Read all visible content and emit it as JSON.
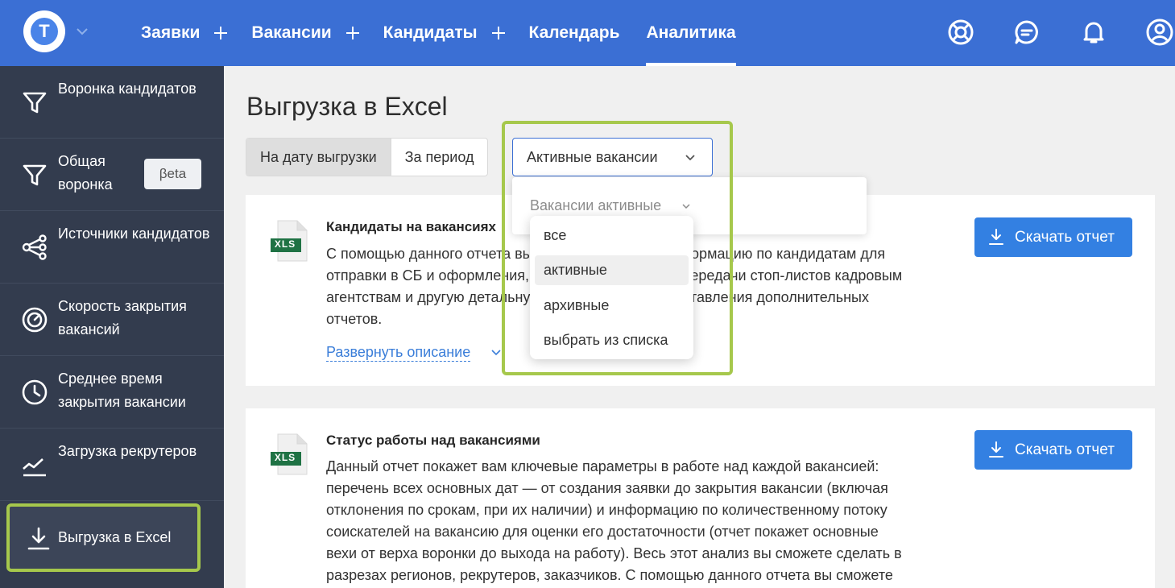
{
  "header": {
    "logo_letter": "T",
    "nav": [
      {
        "label": "Заявки"
      },
      {
        "label": "Вакансии"
      },
      {
        "label": "Кандидаты"
      },
      {
        "label": "Календарь"
      },
      {
        "label": "Аналитика"
      }
    ],
    "icons": [
      "support-icon",
      "chat-icon",
      "bell-icon",
      "user-icon"
    ]
  },
  "sidebar": {
    "items": [
      {
        "label": "Воронка кандидатов",
        "icon": "funnel-icon"
      },
      {
        "label": "Общая воронка",
        "icon": "funnel-icon",
        "badge": "βeta"
      },
      {
        "label": "Источники кандидатов",
        "icon": "share-nodes-icon"
      },
      {
        "label": "Скорость закрытия вакансий",
        "icon": "speedometer-icon"
      },
      {
        "label": "Среднее время закрытия вакансии",
        "icon": "clock-icon"
      },
      {
        "label": "Загрузка рекрутеров",
        "icon": "trend-line-icon"
      },
      {
        "label": "Выгрузка в Excel",
        "icon": "download-icon"
      }
    ]
  },
  "main": {
    "title": "Выгрузка в Excel",
    "tabs": [
      {
        "label": "На дату выгрузки",
        "selected": true
      },
      {
        "label": "За период",
        "selected": false
      }
    ],
    "select": {
      "value": "Активные вакансии"
    },
    "dropdown": {
      "title": "Вакансии активные",
      "options": [
        "все",
        "активные",
        "архивные",
        "выбрать из списка"
      ],
      "highlighted": "активные"
    },
    "cards": [
      {
        "badge": "XLS",
        "title": "Кандидаты на вакансиях",
        "lines": [
          "С помощью данного отчета вы сможете получить информацию по кандидатам для",
          "отправки в СБ и оформления, сделать выгрузку для передачи стоп-листов кадровым",
          "агентствам и другую детальную информацию для составления дополнительных",
          "отчетов."
        ],
        "expand": "Развернуть описание",
        "button": "Скачать отчет"
      },
      {
        "badge": "XLS",
        "title": "Статус работы над вакансиями",
        "lines": [
          "Данный отчет покажет вам ключевые параметры в работе над каждой вакансией:",
          "перечень всех основных дат — от создания заявки до закрытия вакансии (включая",
          "отклонения по срокам, при их наличии) и информацию по количественному потоку",
          "соискателей на вакансию для оценки его достаточности (отчет покажет основные",
          "вехи от верха воронки до выхода на работу). Весь этот анализ вы сможете сделать в",
          "разрезах регионов, рекрутеров, заказчиков. С помощью данного отчета вы сможете"
        ],
        "button": "Скачать отчет"
      }
    ]
  },
  "colors": {
    "header": "#3b6fd4",
    "sidebar": "#333c4e",
    "accent_outline": "#a6c84c",
    "button": "#3380e2",
    "link": "#3b7ed9"
  }
}
